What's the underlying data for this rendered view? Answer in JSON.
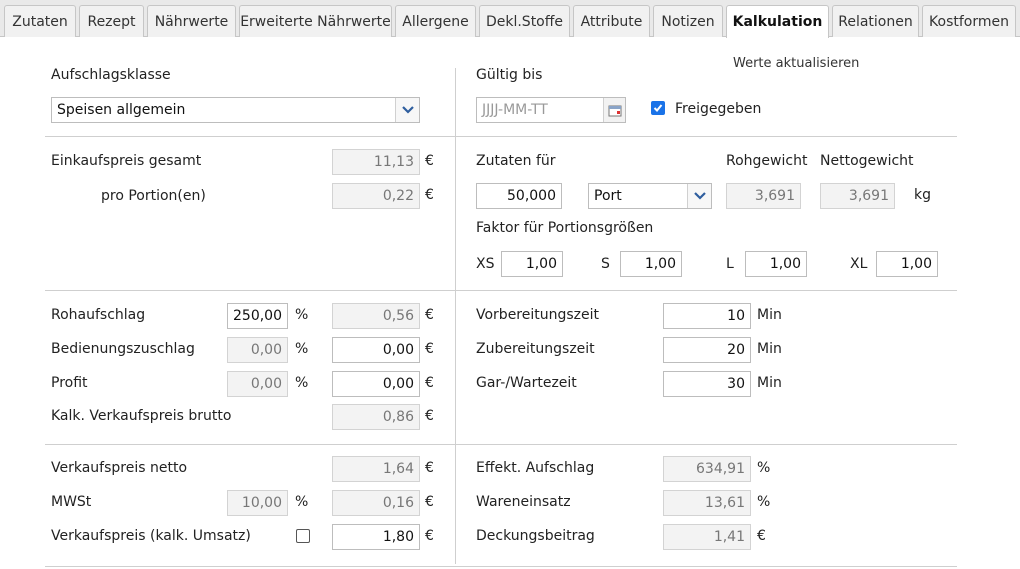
{
  "tabs": [
    {
      "label": "Zutaten",
      "active": false
    },
    {
      "label": "Rezept",
      "active": false
    },
    {
      "label": "Nährwerte",
      "active": false
    },
    {
      "label": "Erweiterte Nährwerte",
      "active": false
    },
    {
      "label": "Allergene",
      "active": false
    },
    {
      "label": "Dekl.Stoffe",
      "active": false
    },
    {
      "label": "Attribute",
      "active": false
    },
    {
      "label": "Notizen",
      "active": false
    },
    {
      "label": "Kalkulation",
      "active": true
    },
    {
      "label": "Relationen",
      "active": false
    },
    {
      "label": "Kostformen",
      "active": false
    }
  ],
  "header": {
    "aufschlagsklasse_label": "Aufschlagsklasse",
    "aufschlagsklasse_value": "Speisen allgemein",
    "gueltig_label": "Gültig bis",
    "gueltig_placeholder": "JJJJ-MM-TT",
    "update_link": "Werte aktualisieren",
    "freigegeben_label": "Freigegeben",
    "freigegeben_checked": true
  },
  "einkauf": {
    "gesamt_label": "Einkaufspreis gesamt",
    "gesamt_value": "11,13",
    "portion_label": "pro Portion(en)",
    "portion_value": "0,22",
    "currency": "€"
  },
  "zutaten": {
    "label": "Zutaten für",
    "amount": "50,000",
    "unit_select": "Port",
    "roh_label": "Rohgewicht",
    "roh_value": "3,691",
    "netto_label": "Nettogewicht",
    "netto_value": "3,691",
    "weight_unit": "kg",
    "faktor_label": "Faktor für Portionsgrößen",
    "sizes": [
      {
        "label": "XS",
        "value": "1,00"
      },
      {
        "label": "S",
        "value": "1,00"
      },
      {
        "label": "L",
        "value": "1,00"
      },
      {
        "label": "XL",
        "value": "1,00"
      }
    ]
  },
  "aufschlag": {
    "roh_label": "Rohaufschlag",
    "roh_pct": "250,00",
    "roh_eur": "0,56",
    "bed_label": "Bedienungszuschlag",
    "bed_pct": "0,00",
    "bed_eur": "0,00",
    "profit_label": "Profit",
    "profit_pct": "0,00",
    "profit_eur": "0,00",
    "kalk_label": "Kalk. Verkaufspreis brutto",
    "kalk_eur": "0,86",
    "pct": "%",
    "currency": "€"
  },
  "zeiten": {
    "vorb_label": "Vorbereitungszeit",
    "vorb_value": "10",
    "zub_label": "Zubereitungszeit",
    "zub_value": "20",
    "gar_label": "Gar-/Wartezeit",
    "gar_value": "30",
    "unit": "Min"
  },
  "verkauf": {
    "netto_label": "Verkaufspreis netto",
    "netto_value": "1,64",
    "mwst_label": "MWSt",
    "mwst_pct": "10,00",
    "mwst_eur": "0,16",
    "umsatz_label": "Verkaufspreis (kalk. Umsatz)",
    "umsatz_checked": false,
    "umsatz_value": "1,80",
    "effekt_label": "Effekt. Aufschlag",
    "effekt_value": "634,91",
    "waren_label": "Wareneinsatz",
    "waren_value": "13,61",
    "deckung_label": "Deckungsbeitrag",
    "deckung_value": "1,41",
    "pct": "%",
    "currency": "€"
  },
  "colors": {
    "checkbox_checked": "#1a73e8",
    "arrow_blue": "#2f5e9e"
  }
}
